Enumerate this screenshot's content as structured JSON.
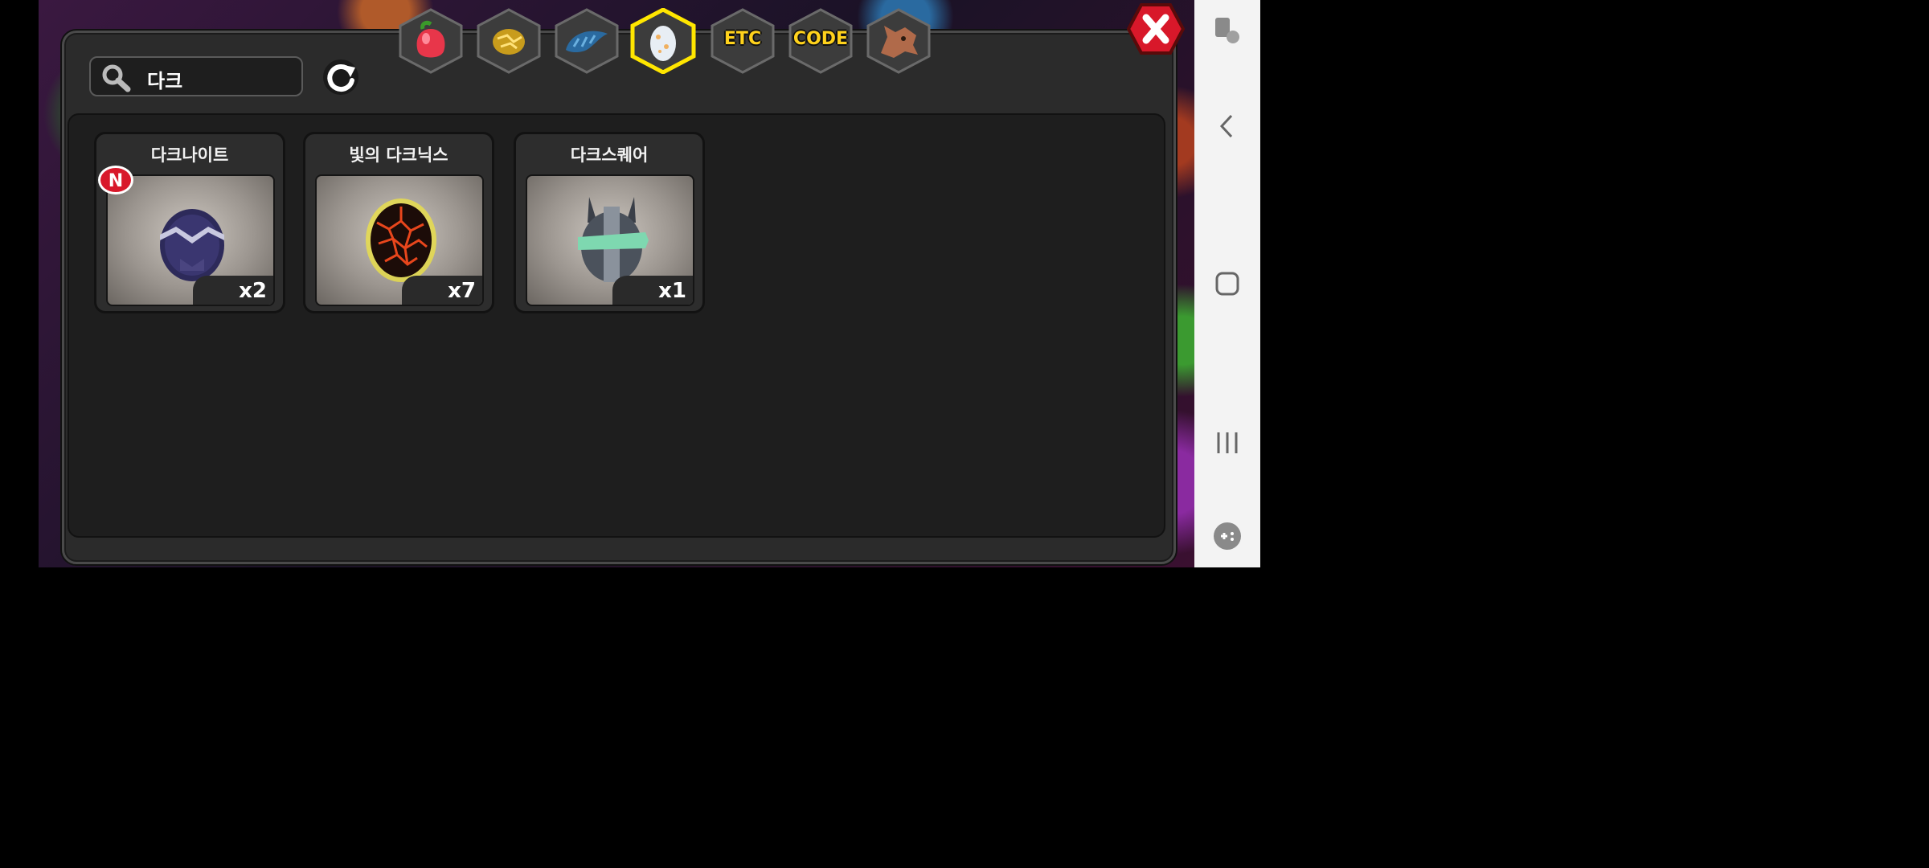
{
  "search": {
    "query": "다크"
  },
  "tabs": [
    {
      "id": "fruit",
      "label": "",
      "icon": "fruit-icon"
    },
    {
      "id": "gold",
      "label": "",
      "icon": "gold-nugget-icon"
    },
    {
      "id": "scale",
      "label": "",
      "icon": "dragon-scale-icon"
    },
    {
      "id": "egg",
      "label": "",
      "icon": "egg-icon",
      "selected": true
    },
    {
      "id": "etc",
      "label": "ETC",
      "icon": ""
    },
    {
      "id": "code",
      "label": "CODE",
      "icon": ""
    },
    {
      "id": "dragon",
      "label": "",
      "icon": "dragon-head-icon"
    }
  ],
  "items": [
    {
      "name": "다크나이트",
      "count": "x2",
      "is_new": true,
      "new_label": "N",
      "icon": "dark-knight-egg-icon"
    },
    {
      "name": "빛의 다크닉스",
      "count": "x7",
      "is_new": false,
      "icon": "lava-egg-icon"
    },
    {
      "name": "다크스퀘어",
      "count": "x1",
      "is_new": false,
      "icon": "armored-egg-icon"
    }
  ],
  "colors": {
    "selected_tab_border": "#ffe600",
    "tab_label": "#ffd21c",
    "close_button": "#d8182a",
    "new_badge": "#d8182a"
  },
  "system_nav": [
    "accessibility-icon",
    "back-icon",
    "home-icon",
    "recents-icon",
    "game-tools-icon"
  ]
}
